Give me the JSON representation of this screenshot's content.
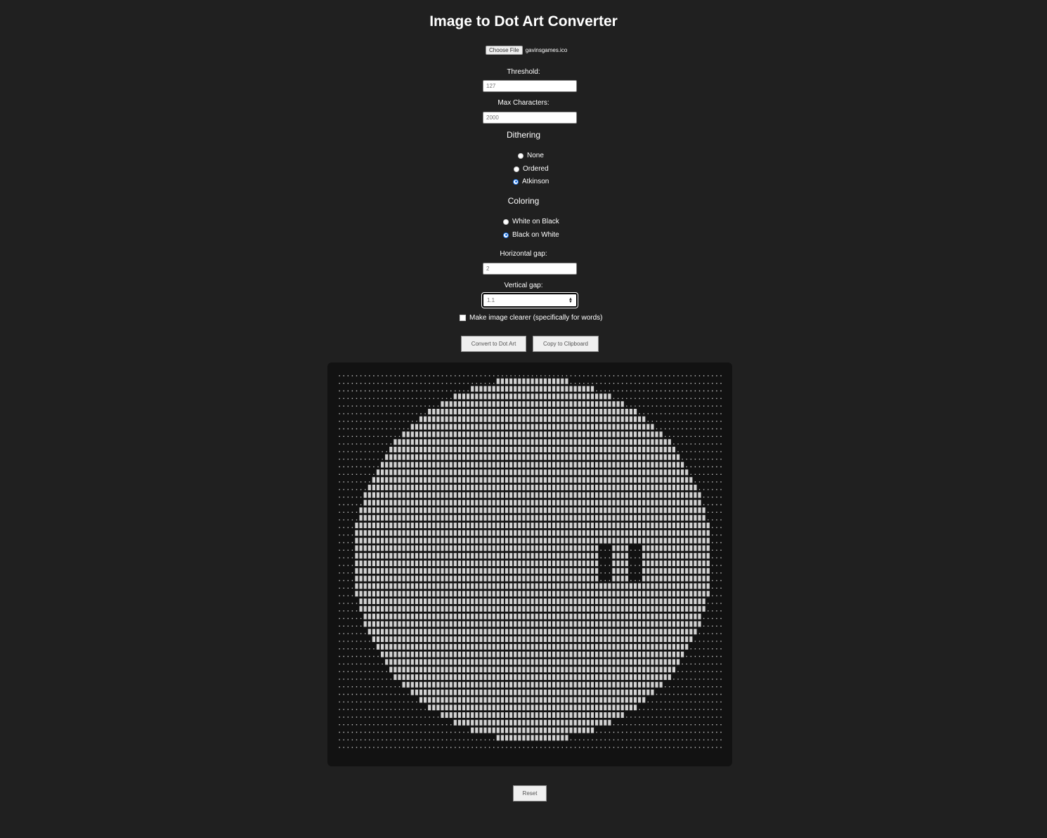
{
  "app": {
    "title": "Image to Dot Art Converter"
  },
  "file": {
    "button_label": "Choose File",
    "file_name": "gavinsgames.ico"
  },
  "threshold": {
    "label": "Threshold:",
    "value": "127"
  },
  "max_characters": {
    "label": "Max Characters:",
    "value": "2000"
  },
  "dithering": {
    "title": "Dithering",
    "options": [
      {
        "label": "None",
        "checked": false
      },
      {
        "label": "Ordered",
        "checked": false
      },
      {
        "label": "Atkinson",
        "checked": true
      }
    ]
  },
  "coloring": {
    "title": "Coloring",
    "options": [
      {
        "label": "White on Black",
        "checked": false
      },
      {
        "label": "Black on White",
        "checked": true
      }
    ]
  },
  "horizontal_gap": {
    "label": "Horizontal gap:",
    "value": "2"
  },
  "vertical_gap": {
    "label": "Vertical gap:",
    "value": "1.1"
  },
  "clarity": {
    "label": "Make image clearer (specifically for words)",
    "checked": false
  },
  "actions": {
    "convert_label": "Convert to Dot Art",
    "copy_label": "Copy to Clipboard",
    "reset_label": "Reset"
  },
  "colors": {
    "page_background": "#202020",
    "output_background": "#121212",
    "radio_accent": "#1a73e8"
  }
}
